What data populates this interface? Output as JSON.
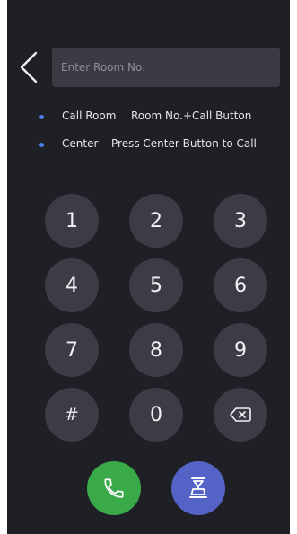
{
  "search": {
    "placeholder": "Enter Room No.",
    "value": ""
  },
  "hints": [
    {
      "title": "Call Room",
      "desc": "Room No.+Call Button"
    },
    {
      "title": "Center",
      "desc": "Press Center Button to Call"
    }
  ],
  "keypad": {
    "keys": [
      "1",
      "2",
      "3",
      "4",
      "5",
      "6",
      "7",
      "8",
      "9",
      "#",
      "0"
    ],
    "backspace_icon": "backspace-icon"
  },
  "actions": {
    "call_icon": "phone-icon",
    "center_icon": "management-center-icon"
  },
  "colors": {
    "background": "#1f1f26",
    "key": "#3c3c46",
    "input": "#3b3b44",
    "call": "#3aa948",
    "center": "#5563c7",
    "bullet": "#4d7ef2"
  }
}
